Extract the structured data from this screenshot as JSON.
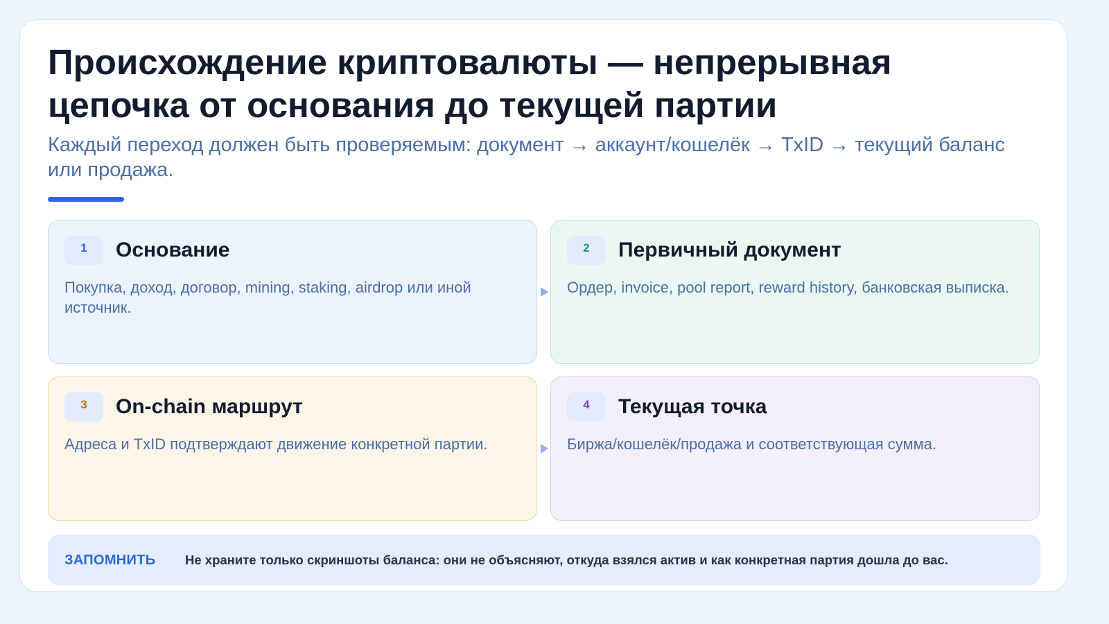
{
  "slide": {
    "title": "Происхождение криптовалюты — непрерывная цепочка от основания до текущей партии",
    "subtitle": "Каждый переход должен быть проверяемым: документ → аккаунт/кошелёк → TxID → текущий баланс или продажа."
  },
  "steps": [
    {
      "number": "1",
      "title": "Основание",
      "text": "Покупка, доход, договор, mining, staking, airdrop или иной источник."
    },
    {
      "number": "2",
      "title": "Первичный документ",
      "text": "Ордер, invoice, pool report, reward history, банковская выписка."
    },
    {
      "number": "3",
      "title": "On-chain маршрут",
      "text": "Адреса и TxID подтверждают движение конкретной партии."
    },
    {
      "number": "4",
      "title": "Текущая точка",
      "text": "Биржа/кошелёк/продажа и соответствующая сумма."
    }
  ],
  "note": {
    "label": "ЗАПОМНИТЬ",
    "text": "Не храните только скриншоты баланса: они не объясняют, откуда взялся актив и как конкретная партия дошла до вас."
  },
  "colors": {
    "accent": "#2f66e0",
    "step1": "#2f66e0",
    "step2": "#1f9a66",
    "step3": "#c56f12",
    "step4": "#7a3fd1"
  },
  "icons": {
    "connector": "arrow-right-icon"
  }
}
